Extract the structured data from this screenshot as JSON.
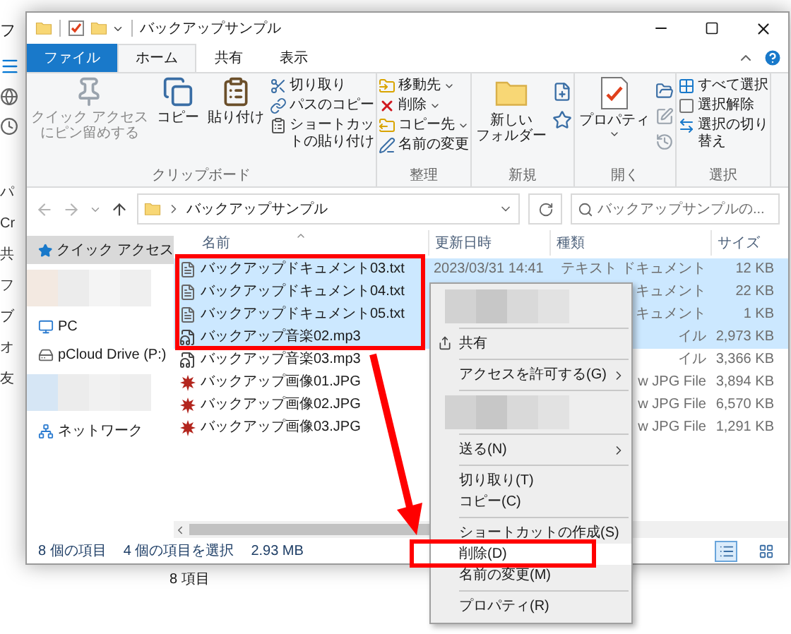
{
  "background_window": {
    "title_fragment": "フ",
    "nav_labels": [
      "パ",
      "Cr",
      "共",
      "フ",
      "ブ",
      "オ",
      "友"
    ],
    "status": "8 項目"
  },
  "window": {
    "title": "バックアップサンプル"
  },
  "file_menu": "ファイル",
  "tabs": [
    {
      "label": "ホーム",
      "selected": true
    },
    {
      "label": "共有",
      "selected": false
    },
    {
      "label": "表示",
      "selected": false
    }
  ],
  "ribbon": {
    "groups": [
      {
        "kind": "clipboard",
        "label": "クリップボード",
        "large": [
          {
            "lines": [
              "クイック アクセス",
              "にピン留めする"
            ],
            "kind": "pin",
            "disabled": true,
            "dropdown": false
          },
          {
            "lines": [
              "コピー"
            ],
            "kind": "copy",
            "disabled": false,
            "dropdown": false
          },
          {
            "lines": [
              "貼り付け"
            ],
            "kind": "paste",
            "disabled": false,
            "dropdown": false
          }
        ],
        "small": [
          {
            "label": "切り取り",
            "kind": "cut",
            "dropdown": false
          },
          {
            "label": "パスのコピー",
            "kind": "path",
            "dropdown": false
          },
          {
            "label": "ショートカットの貼り付け",
            "kind": "shortcut",
            "dropdown": false
          }
        ]
      },
      {
        "kind": "organize",
        "label": "整理",
        "small": [
          {
            "label": "移動先",
            "kind": "move",
            "dropdown": true
          },
          {
            "label": "削除",
            "kind": "delete",
            "dropdown": true
          },
          {
            "label": "コピー先",
            "kind": "copyto",
            "dropdown": true
          },
          {
            "label": "名前の変更",
            "kind": "rename",
            "dropdown": false
          }
        ]
      },
      {
        "kind": "new",
        "label": "新規",
        "large": [
          {
            "lines": [
              "新しい",
              "フォルダー"
            ],
            "kind": "folder",
            "disabled": false,
            "dropdown": false
          }
        ]
      },
      {
        "kind": "open",
        "label": "開く",
        "large": [
          {
            "lines": [
              "プロパティ"
            ],
            "kind": "properties",
            "disabled": false,
            "dropdown": true
          }
        ]
      },
      {
        "kind": "select",
        "label": "選択",
        "small": [
          {
            "label": "すべて選択",
            "kind": "selectall",
            "dropdown": false
          },
          {
            "label": "選択解除",
            "kind": "deselect",
            "dropdown": false
          },
          {
            "label": "選択の切り替え",
            "kind": "invert",
            "dropdown": false
          }
        ]
      }
    ]
  },
  "address_bar": {
    "path": "バックアップサンプル",
    "search_placeholder": "バックアップサンプルの..."
  },
  "nav_pane": {
    "items": [
      {
        "kind": "quick",
        "label": "クイック アクセス",
        "selected": true
      },
      {
        "kind": "mosaic"
      },
      {
        "kind": "pc",
        "label": "PC",
        "selected": false
      },
      {
        "kind": "drive",
        "label": "pCloud Drive (P:)",
        "selected": false
      },
      {
        "kind": "mosaic"
      },
      {
        "kind": "network",
        "label": "ネットワーク",
        "selected": false
      }
    ]
  },
  "file_list": {
    "columns": [
      "名前",
      "更新日時",
      "種類",
      "サイズ"
    ],
    "rows": [
      {
        "name": "バックアップドキュメント03.txt",
        "kind": "text",
        "selected": true,
        "date": "2023/03/31 14:41",
        "type": "テキスト ドキュメント",
        "size": "12 KB"
      },
      {
        "name": "バックアップドキュメント04.txt",
        "kind": "text",
        "selected": true,
        "type": "キュメント",
        "size": "22 KB"
      },
      {
        "name": "バックアップドキュメント05.txt",
        "kind": "text",
        "selected": true,
        "type": "キュメント",
        "size": "1 KB"
      },
      {
        "name": "バックアップ音楽02.mp3",
        "kind": "audio",
        "selected": true,
        "type": "イル",
        "size": "2,973 KB"
      },
      {
        "name": "バックアップ音楽03.mp3",
        "kind": "audio",
        "selected": false,
        "type": "イル",
        "size": "3,366 KB"
      },
      {
        "name": "バックアップ画像01.JPG",
        "kind": "image",
        "selected": false,
        "type": "w JPG File",
        "size": "3,894 KB"
      },
      {
        "name": "バックアップ画像02.JPG",
        "kind": "image",
        "selected": false,
        "type": "w JPG File",
        "size": "6,570 KB"
      },
      {
        "name": "バックアップ画像03.JPG",
        "kind": "image",
        "selected": false,
        "type": "w JPG File",
        "size": "1,291 KB"
      }
    ]
  },
  "context_menu": {
    "items": [
      {
        "kind": "mosaic"
      },
      {
        "kind": "separator"
      },
      {
        "kind": "share",
        "label": "共有",
        "submenu": false,
        "selected": false
      },
      {
        "kind": "separator"
      },
      {
        "kind": "item",
        "label": "アクセスを許可する(G)",
        "submenu": true,
        "selected": false
      },
      {
        "kind": "separator"
      },
      {
        "kind": "mosaic"
      },
      {
        "kind": "separator"
      },
      {
        "kind": "item",
        "label": "送る(N)",
        "submenu": true,
        "selected": false
      },
      {
        "kind": "separator"
      },
      {
        "kind": "item",
        "label": "切り取り(T)",
        "submenu": false,
        "selected": false
      },
      {
        "kind": "item",
        "label": "コピー(C)",
        "submenu": false,
        "selected": false
      },
      {
        "kind": "separator"
      },
      {
        "kind": "item",
        "label": "ショートカットの作成(S)",
        "submenu": false,
        "selected": false
      },
      {
        "kind": "item",
        "label": "削除(D)",
        "submenu": false,
        "selected": true
      },
      {
        "kind": "item",
        "label": "名前の変更(M)",
        "submenu": false,
        "selected": false
      },
      {
        "kind": "separator"
      },
      {
        "kind": "item",
        "label": "プロパティ(R)",
        "submenu": false,
        "selected": false
      }
    ]
  },
  "status_bar": {
    "count": "8 個の項目",
    "selection": "4 個の項目を選択",
    "size": "2.93 MB"
  },
  "view_buttons": [
    {
      "kind": "details",
      "selected": true
    },
    {
      "kind": "tiles",
      "selected": false
    }
  ]
}
